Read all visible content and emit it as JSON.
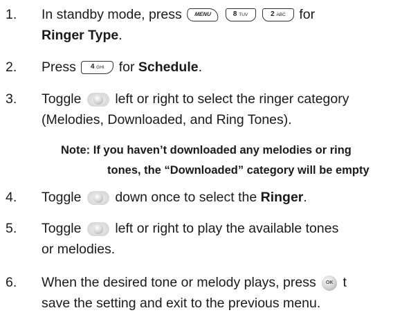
{
  "steps": [
    {
      "num": "1.",
      "a": "In standby mode, press",
      "b": "for",
      "bold": "Ringer Type",
      "end": "."
    },
    {
      "num": "2.",
      "a": "Press",
      "b": "for",
      "bold": "Schedule",
      "end": "."
    },
    {
      "num": "3.",
      "a": "Toggle",
      "b": "left or right to select the ringer category",
      "line2": "(Melodies, Downloaded, and Ring Tones)."
    },
    {
      "num": "4.",
      "a": "Toggle",
      "b": "down once to select the",
      "bold": "Ringer",
      "end": "."
    },
    {
      "num": "5.",
      "a": "Toggle",
      "b": "left or right to play the available tones",
      "line2": "or melodies."
    },
    {
      "num": "6.",
      "a": "When the desired tone or melody plays, press",
      "b": "t",
      "line2": "save the setting and exit to the previous menu."
    }
  ],
  "note": {
    "line1": "Note: If you haven’t downloaded any melodies or ring",
    "line2": "tones, the “Downloaded” category will be empty"
  },
  "keys": {
    "menu": "MENU",
    "k8": "8",
    "k8_letters": "TUV",
    "k2": "2",
    "k2_letters": "ABC",
    "k4": "4",
    "k4_letters": "GHI",
    "ok": "OK"
  }
}
